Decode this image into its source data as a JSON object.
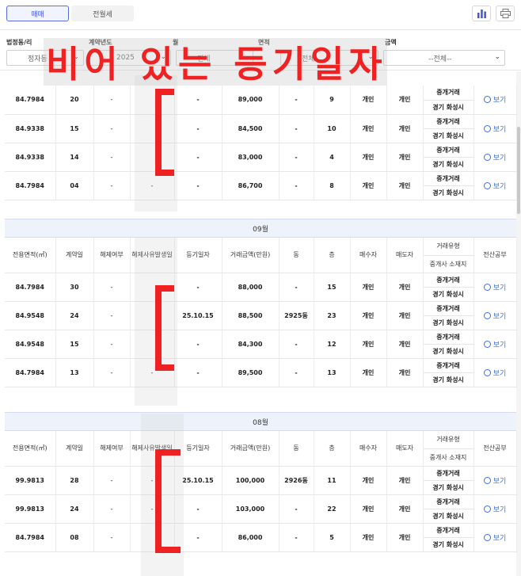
{
  "tabs": {
    "sale": "매매",
    "rent": "전월세"
  },
  "icons": {
    "chart": "bar-chart-icon",
    "print": "printer-icon"
  },
  "filters": {
    "dong_label": "법정동/리",
    "dong_value": "정자동",
    "year_label": "계약년도",
    "year_value": "2025",
    "month_label": "월",
    "month_value": "전체",
    "area_label": "면적",
    "area_value": "전체",
    "price_label": "금액",
    "price_value": "--전체--"
  },
  "overlay": {
    "text": "비어 있는 등기일자"
  },
  "colors": {
    "accent": "#4455d6",
    "annotation": "#ee2222",
    "link": "#3a6fd8"
  },
  "headers": {
    "area": "전용면적(㎡)",
    "day": "계약일",
    "cancel": "해제여부",
    "cancel_date": "해제사유발생일",
    "reg_date": "등기일자",
    "price": "거래금액(만원)",
    "building": "동",
    "floor": "층",
    "buyer": "매수자",
    "seller": "매도자",
    "deal_type": "거래유형",
    "agent_loc": "중개사 소재지",
    "registry": "전산공부"
  },
  "deal_type_value": "중개거래",
  "agent_loc_value": "경기 화성시",
  "view_label": "보기",
  "sections": [
    {
      "month": "",
      "rows": [
        {
          "area": "84.7984",
          "day": "20",
          "cancel": "-",
          "cdate": "",
          "reg": "-",
          "price": "89,000",
          "bld": "-",
          "floor": "9",
          "buyer": "개인",
          "seller": "개인"
        },
        {
          "area": "84.9338",
          "day": "15",
          "cancel": "-",
          "cdate": "",
          "reg": "-",
          "price": "84,500",
          "bld": "-",
          "floor": "10",
          "buyer": "개인",
          "seller": "개인"
        },
        {
          "area": "84.9338",
          "day": "14",
          "cancel": "-",
          "cdate": "",
          "reg": "-",
          "price": "83,000",
          "bld": "-",
          "floor": "4",
          "buyer": "개인",
          "seller": "개인"
        },
        {
          "area": "84.7984",
          "day": "04",
          "cancel": "-",
          "cdate": "-",
          "reg": "-",
          "price": "86,700",
          "bld": "-",
          "floor": "8",
          "buyer": "개인",
          "seller": "개인"
        }
      ]
    },
    {
      "month": "09월",
      "rows": [
        {
          "area": "84.7984",
          "day": "30",
          "cancel": "-",
          "cdate": "",
          "reg": "-",
          "price": "88,000",
          "bld": "-",
          "floor": "15",
          "buyer": "개인",
          "seller": "개인"
        },
        {
          "area": "84.9548",
          "day": "24",
          "cancel": "-",
          "cdate": "",
          "reg": "25.10.15",
          "price": "88,500",
          "bld": "2925동",
          "floor": "23",
          "buyer": "개인",
          "seller": "개인"
        },
        {
          "area": "84.9548",
          "day": "15",
          "cancel": "-",
          "cdate": "",
          "reg": "-",
          "price": "84,300",
          "bld": "-",
          "floor": "12",
          "buyer": "개인",
          "seller": "개인"
        },
        {
          "area": "84.7984",
          "day": "13",
          "cancel": "-",
          "cdate": "-",
          "reg": "-",
          "price": "89,500",
          "bld": "-",
          "floor": "13",
          "buyer": "개인",
          "seller": "개인"
        }
      ]
    },
    {
      "month": "08월",
      "rows": [
        {
          "area": "99.9813",
          "day": "28",
          "cancel": "-",
          "cdate": "-",
          "reg": "25.10.15",
          "price": "100,000",
          "bld": "2926동",
          "floor": "11",
          "buyer": "개인",
          "seller": "개인"
        },
        {
          "area": "99.9813",
          "day": "24",
          "cancel": "-",
          "cdate": "-",
          "reg": "-",
          "price": "103,000",
          "bld": "-",
          "floor": "22",
          "buyer": "개인",
          "seller": "개인"
        },
        {
          "area": "84.7984",
          "day": "08",
          "cancel": "-",
          "cdate": "",
          "reg": "-",
          "price": "86,000",
          "bld": "-",
          "floor": "5",
          "buyer": "개인",
          "seller": "개인"
        }
      ]
    }
  ]
}
